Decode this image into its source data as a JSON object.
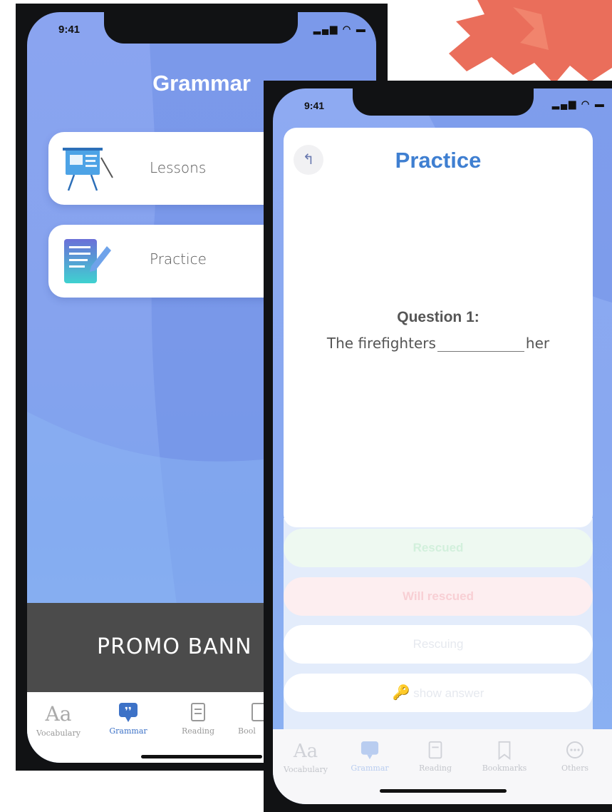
{
  "back_screen": {
    "status_time": "9:41",
    "title": "Grammar",
    "menu": [
      {
        "label": "Lessons",
        "icon": "presentation-board-icon"
      },
      {
        "label": "Practice",
        "icon": "notepad-pencil-icon"
      }
    ],
    "promo_text": "PROMO BANN",
    "tabs": [
      {
        "label": "Vocabulary",
        "icon": "aa-letters-icon"
      },
      {
        "label": "Grammar",
        "icon": "speech-bubble-icon"
      },
      {
        "label": "Reading",
        "icon": "document-icon"
      },
      {
        "label": "Bool",
        "icon": "bookmark-icon"
      }
    ]
  },
  "front_screen": {
    "status_time": "9:41",
    "title": "Practice",
    "back_symbol": "↰",
    "question_label": "Question 1:",
    "question_before": "The firefighters",
    "question_after": "her",
    "answers": [
      {
        "label": "Rescued",
        "bg": "#eef9f1",
        "color": "#d2f0dc"
      },
      {
        "label": "Will rescued",
        "bg": "#fdeef0",
        "color": "#f8cfd4"
      },
      {
        "label": "Rescuing",
        "bg": "#ffffff",
        "color": "#e6e9ef"
      },
      {
        "label": "show answer",
        "bg": "#ffffff",
        "color": "#e6e9ef",
        "icon": "key-icon"
      }
    ],
    "tabs": [
      {
        "label": "Vocabulary",
        "icon": "aa-letters-icon"
      },
      {
        "label": "Grammar",
        "icon": "speech-bubble-icon"
      },
      {
        "label": "Reading",
        "icon": "document-icon"
      },
      {
        "label": "Bookmarks",
        "icon": "bookmark-icon"
      },
      {
        "label": "Others",
        "icon": "more-dots-icon"
      }
    ]
  },
  "colors": {
    "accent_blue": "#3f7fd1",
    "grammar_tab_active": "#3d72c7",
    "background_gradient": "#8aa4f0",
    "promo_gray": "#4b4b4b",
    "brush_red": "#e8624d"
  }
}
